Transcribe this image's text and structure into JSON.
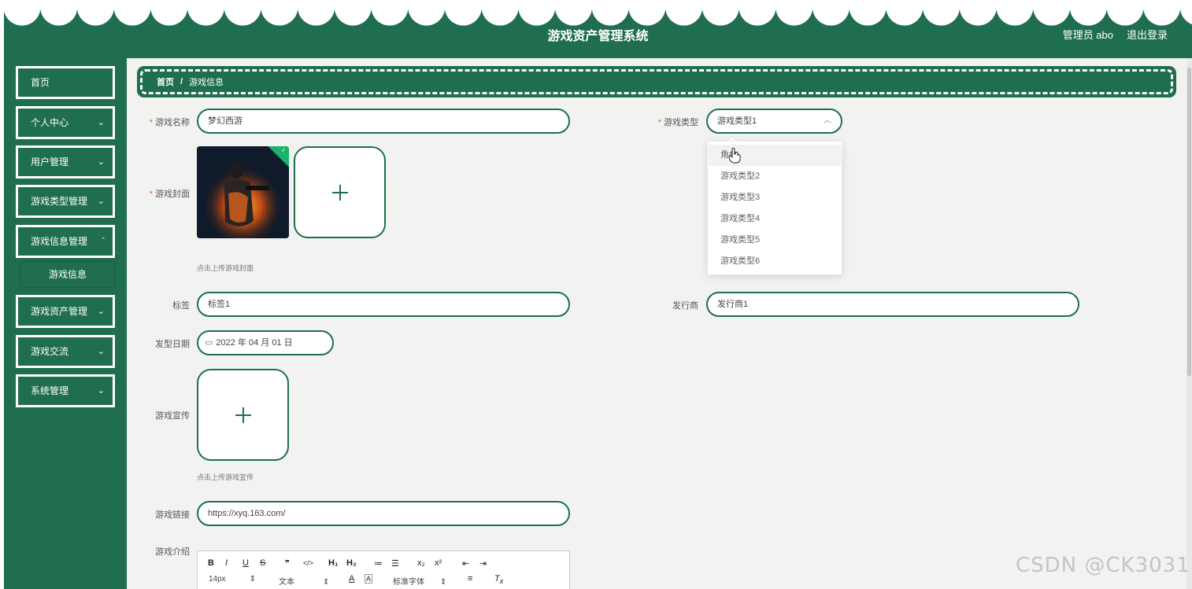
{
  "header": {
    "title": "游戏资产管理系统",
    "user": "管理员 abo",
    "logout": "退出登录"
  },
  "sidebar": {
    "items": [
      {
        "label": "首页",
        "has_children": false
      },
      {
        "label": "个人中心",
        "has_children": true
      },
      {
        "label": "用户管理",
        "has_children": true
      },
      {
        "label": "游戏类型管理",
        "has_children": true
      },
      {
        "label": "游戏信息管理",
        "has_children": true,
        "expanded": true
      },
      {
        "label": "游戏资产管理",
        "has_children": true
      },
      {
        "label": "游戏交流",
        "has_children": true
      },
      {
        "label": "系统管理",
        "has_children": true
      }
    ],
    "subitem": "游戏信息",
    "chevron": "⌄"
  },
  "breadcrumb": {
    "home": "首页",
    "separator": "/",
    "current": "游戏信息"
  },
  "form": {
    "name_label": "游戏名称",
    "name_value": "梦幻西游",
    "type_label": "游戏类型",
    "type_value": "游戏类型1",
    "cover_label": "游戏封面",
    "cover_hint": "点击上传游戏封面",
    "tag_label": "标签",
    "tag_value": "标签1",
    "publisher_label": "发行商",
    "publisher_value": "发行商1",
    "date_label": "发型日期",
    "date_value": "2022 年 04 月 01 日",
    "promo_label": "游戏宣传",
    "promo_hint": "点击上传游戏宣传",
    "link_label": "游戏链接",
    "link_value": "https://xyq.163.com/",
    "intro_label": "游戏介绍",
    "required_mark": "*"
  },
  "dropdown": {
    "options": [
      "角色",
      "游戏类型2",
      "游戏类型3",
      "游戏类型4",
      "游戏类型5",
      "游戏类型6"
    ],
    "hovered_index": 0
  },
  "editor": {
    "row1": [
      "B",
      "I",
      "U",
      "S",
      "❞",
      "</>",
      "H₁",
      "H₂",
      "≔",
      "☰",
      "x₂",
      "x²",
      "⇤",
      "⇥"
    ],
    "size": "14px",
    "text_style": "文本",
    "font": "标准字体",
    "select_caret": "⇕"
  },
  "watermark": "CSDN @CK3031",
  "colors": {
    "brand": "#1e6e4f",
    "background": "#f2f2f0",
    "required": "#e05a5a",
    "success": "#19b36b"
  }
}
